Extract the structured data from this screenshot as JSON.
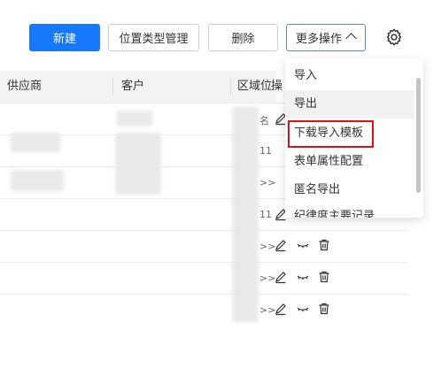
{
  "toolbar": {
    "new_label": "新建",
    "location_type_label": "位置类型管理",
    "delete_label": "删除",
    "more_label": "更多操作"
  },
  "table": {
    "headers": [
      "供应商",
      "客户",
      "区域位",
      "操"
    ],
    "region_values": [
      "名",
      "11",
      ">>",
      "11",
      ">>",
      ">>",
      ">>"
    ]
  },
  "more_menu": {
    "items": [
      "导入",
      "导出",
      "下载导入模板",
      "表单属性配置",
      "匿名导出",
      "纪律度主要记录"
    ]
  },
  "colors": {
    "primary": "#1677ff",
    "highlight_border": "#d8131b"
  },
  "icons": [
    "settings-gear-icon",
    "edit-pencil-icon",
    "eye-hidden-icon",
    "trash-icon",
    "chevron-up-icon"
  ]
}
